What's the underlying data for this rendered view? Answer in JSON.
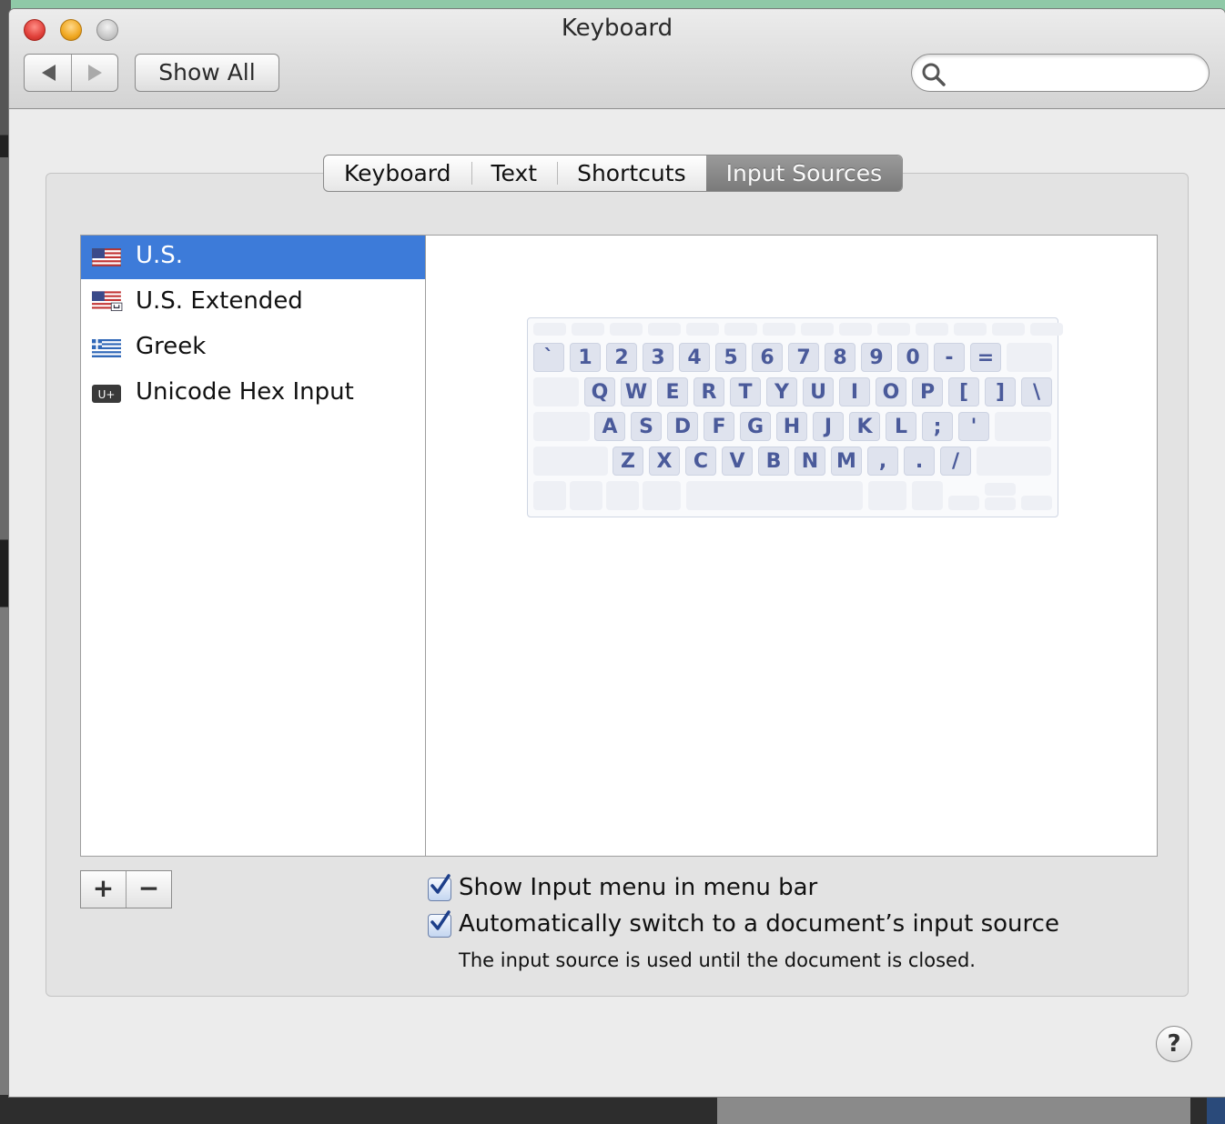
{
  "window": {
    "title": "Keyboard"
  },
  "toolbar": {
    "show_all_label": "Show All",
    "search_placeholder": ""
  },
  "tabs": [
    {
      "label": "Keyboard",
      "active": false
    },
    {
      "label": "Text",
      "active": false
    },
    {
      "label": "Shortcuts",
      "active": false
    },
    {
      "label": "Input Sources",
      "active": true
    }
  ],
  "input_sources": [
    {
      "label": "U.S.",
      "icon": "us-flag-icon",
      "selected": true
    },
    {
      "label": "U.S. Extended",
      "icon": "us-extended-flag-icon",
      "selected": false
    },
    {
      "label": "Greek",
      "icon": "greek-flag-icon",
      "selected": false
    },
    {
      "label": "Unicode Hex Input",
      "icon": "unicode-hex-icon",
      "icon_text": "U+",
      "selected": false
    }
  ],
  "keyboard_preview": {
    "rows": [
      [
        "`",
        "1",
        "2",
        "3",
        "4",
        "5",
        "6",
        "7",
        "8",
        "9",
        "0",
        "-",
        "="
      ],
      [
        "Q",
        "W",
        "E",
        "R",
        "T",
        "Y",
        "U",
        "I",
        "O",
        "P",
        "[",
        "]",
        "\\"
      ],
      [
        "A",
        "S",
        "D",
        "F",
        "G",
        "H",
        "J",
        "K",
        "L",
        ";",
        "'"
      ],
      [
        "Z",
        "X",
        "C",
        "V",
        "B",
        "N",
        "M",
        ",",
        ".",
        "/"
      ]
    ]
  },
  "list_controls": {
    "add_label": "+",
    "remove_label": "−"
  },
  "options": {
    "show_input_menu": {
      "label": "Show Input menu in menu bar",
      "checked": true
    },
    "auto_switch": {
      "label": "Automatically switch to a document’s input source",
      "checked": true
    },
    "auto_switch_note": "The input source is used until the document is closed."
  },
  "help_label": "?",
  "colors": {
    "selection": "#3d7bd9",
    "key_text": "#4a5a9a",
    "check": "#1d3f8a"
  }
}
